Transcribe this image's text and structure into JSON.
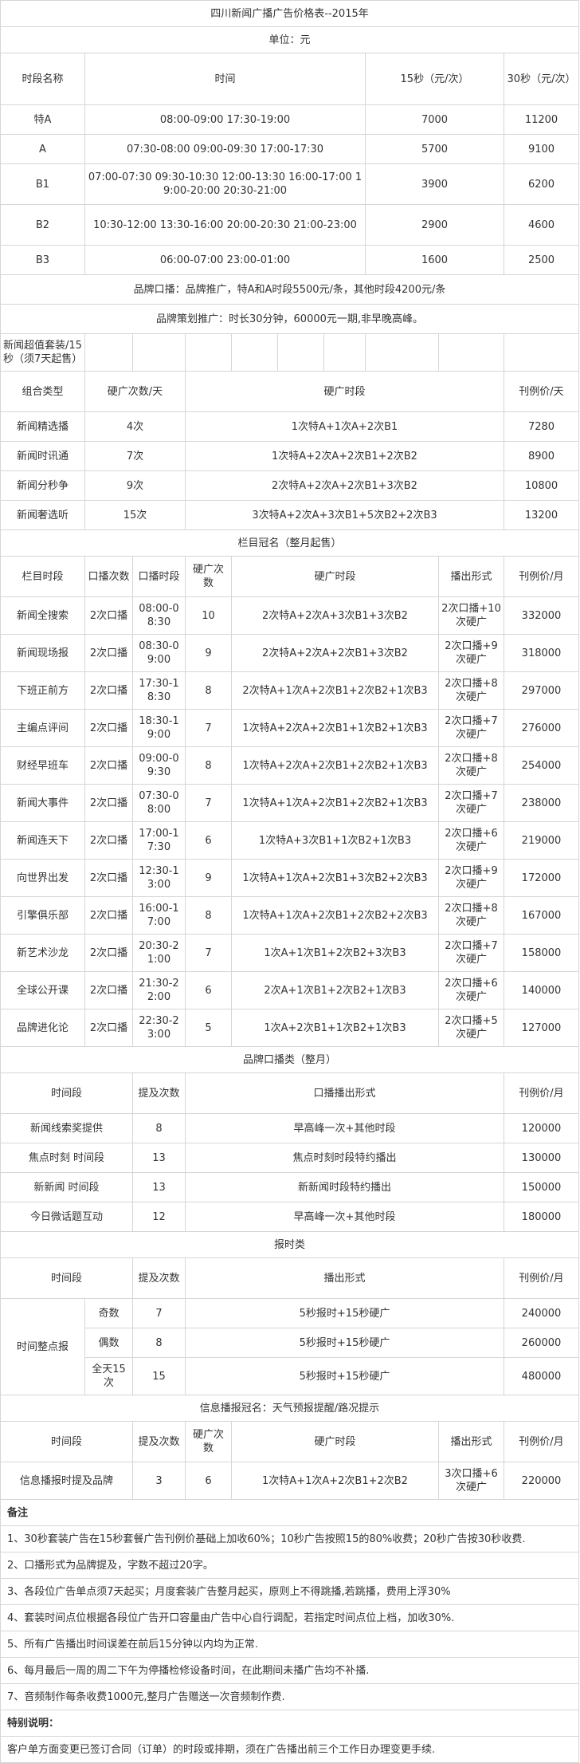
{
  "title": "四川新闻广播广告价格表--2015年",
  "unit": "单位：元",
  "rates": {
    "headers": [
      "时段名称",
      "时间",
      "15秒（元/次）",
      "30秒（元/次）"
    ],
    "rows": [
      [
        "特A",
        "08:00-09:00 17:30-19:00",
        "7000",
        "11200"
      ],
      [
        "A",
        "07:30-08:00 09:00-09:30 17:00-17:30",
        "5700",
        "9100"
      ],
      [
        "B1",
        "07:00-07:30 09:30-10:30 12:00-13:30 16:00-17:00 19:00-20:00 20:30-21:00",
        "3900",
        "6200"
      ],
      [
        "B2",
        "10:30-12:00 13:30-16:00 20:00-20:30 21:00-23:00",
        "2900",
        "4600"
      ],
      [
        "B3",
        "06:00-07:00 23:00-01:00",
        "1600",
        "2500"
      ]
    ],
    "brand_note": "品牌口播：品牌推广，特A和A时段5500元/条，其他时段4200元/条",
    "planning_note": "品牌策划推广：时长30分钟，60000元一期,非早晚高峰。"
  },
  "combo": {
    "title": "新闻超值套装/15秒（须7天起售）",
    "headers": [
      "组合类型",
      "硬广次数/天",
      "硬广时段",
      "刊例价/天"
    ],
    "rows": [
      [
        "新闻精选播",
        "4次",
        "1次特A+1次A+2次B1",
        "7280"
      ],
      [
        "新闻时讯通",
        "7次",
        "1次特A+2次A+2次B1+2次B2",
        "8900"
      ],
      [
        "新闻分秒争",
        "9次",
        "2次特A+2次A+2次B1+3次B2",
        "10800"
      ],
      [
        "新闻奢选听",
        "15次",
        "3次特A+2次A+3次B1+5次B2+2次B3",
        "13200"
      ]
    ]
  },
  "program": {
    "title": "栏目冠名（整月起售）",
    "headers": [
      "栏目时段",
      "口播次数",
      "口播时段",
      "硬广次数",
      "硬广时段",
      "播出形式",
      "刊例价/月"
    ],
    "rows": [
      [
        "新闻全搜索",
        "2次口播",
        "08:00-08:30",
        "10",
        "2次特A+2次A+3次B1+3次B2",
        "2次口播+10次硬广",
        "332000"
      ],
      [
        "新闻现场报",
        "2次口播",
        "08:30-09:00",
        "9",
        "2次特A+2次A+2次B1+3次B2",
        "2次口播+9次硬广",
        "318000"
      ],
      [
        "下班正前方",
        "2次口播",
        "17:30-18:30",
        "8",
        "2次特A+1次A+2次B1+2次B2+1次B3",
        "2次口播+8次硬广",
        "297000"
      ],
      [
        "主编点评间",
        "2次口播",
        "18:30-19:00",
        "7",
        "1次特A+2次A+2次B1+1次B2+1次B3",
        "2次口播+7次硬广",
        "276000"
      ],
      [
        "财经早班车",
        "2次口播",
        "09:00-09:30",
        "8",
        "1次特A+2次A+2次B1+2次B2+1次B3",
        "2次口播+8次硬广",
        "254000"
      ],
      [
        "新闻大事件",
        "2次口播",
        "07:30-08:00",
        "7",
        "1次特A+1次A+2次B1+2次B2+1次B3",
        "2次口播+7次硬广",
        "238000"
      ],
      [
        "新闻连天下",
        "2次口播",
        "17:00-17:30",
        "6",
        "1次特A+3次B1+1次B2+1次B3",
        "2次口播+6次硬广",
        "219000"
      ],
      [
        "向世界出发",
        "2次口播",
        "12:30-13:00",
        "9",
        "1次特A+1次A+2次B1+3次B2+2次B3",
        "2次口播+9次硬广",
        "172000"
      ],
      [
        "引擎俱乐部",
        "2次口播",
        "16:00-17:00",
        "8",
        "1次特A+1次A+2次B1+2次B2+2次B3",
        "2次口播+8次硬广",
        "167000"
      ],
      [
        "新艺术沙龙",
        "2次口播",
        "20:30-21:00",
        "7",
        "1次A+1次B1+2次B2+3次B3",
        "2次口播+7次硬广",
        "158000"
      ],
      [
        "全球公开课",
        "2次口播",
        "21:30-22:00",
        "6",
        "2次A+1次B1+2次B2+1次B3",
        "2次口播+6次硬广",
        "140000"
      ],
      [
        "品牌进化论",
        "2次口播",
        "22:30-23:00",
        "5",
        "1次A+2次B1+1次B2+1次B3",
        "2次口播+5次硬广",
        "127000"
      ]
    ]
  },
  "brand_broadcast": {
    "title": "品牌口播类（整月）",
    "headers": [
      "时间段",
      "提及次数",
      "口播播出形式",
      "刊例价/月"
    ],
    "rows": [
      [
        "新闻线索奖提供",
        "8",
        "早高峰一次+其他时段",
        "120000"
      ],
      [
        "焦点时刻 时间段",
        "13",
        "焦点时刻时段特约播出",
        "130000"
      ],
      [
        "新新闻 时间段",
        "13",
        "新新闻时段特约播出",
        "150000"
      ],
      [
        "今日微话题互动",
        "12",
        "早高峰一次+其他时段",
        "180000"
      ]
    ]
  },
  "time_signal": {
    "title": "报时类",
    "headers": [
      "时间段",
      "提及次数",
      "播出形式",
      "刊例价/月"
    ],
    "group": "时间整点报",
    "rows": [
      [
        "奇数",
        "7",
        "5秒报时+15秒硬广",
        "240000"
      ],
      [
        "偶数",
        "8",
        "5秒报时+15秒硬广",
        "260000"
      ],
      [
        "全天15次",
        "15",
        "5秒报时+15秒硬广",
        "480000"
      ]
    ]
  },
  "info": {
    "title": "信息播报冠名：天气预报提醒/路况提示",
    "headers": [
      "时间段",
      "提及次数",
      "硬广次数",
      "硬广时段",
      "播出形式",
      "刊例价/月"
    ],
    "row": [
      "信息播报时提及品牌",
      "3",
      "6",
      "1次特A+1次A+2次B1+2次B2",
      "3次口播+6次硬广",
      "220000"
    ]
  },
  "notes": {
    "title": "备注",
    "items": [
      "1、30秒套装广告在15秒套餐广告刊例价基础上加收60%；10秒广告按照15的80%收费；20秒广告按30秒收费.",
      "2、口播形式为品牌提及，字数不超过20字。",
      "3、各段位广告单点须7天起买；月度套装广告整月起买，原则上不得跳播,若跳播，费用上浮30%",
      "4、套装时间点位根据各段位广告开口容量由广告中心自行调配，若指定时间点位上档，加收30%.",
      "5、所有广告播出时间误差在前后15分钟以内均为正常.",
      "6、每月最后一周的周二下午为停播检修设备时间，在此期间未播广告均不补播.",
      "7、音频制作每条收费1000元,整月广告赠送一次音频制作费."
    ],
    "special_title": "特别说明：",
    "special_text": "客户单方面变更已签订合同（订单）的时段或排期，须在广告播出前三个工作日办理变更手续."
  }
}
